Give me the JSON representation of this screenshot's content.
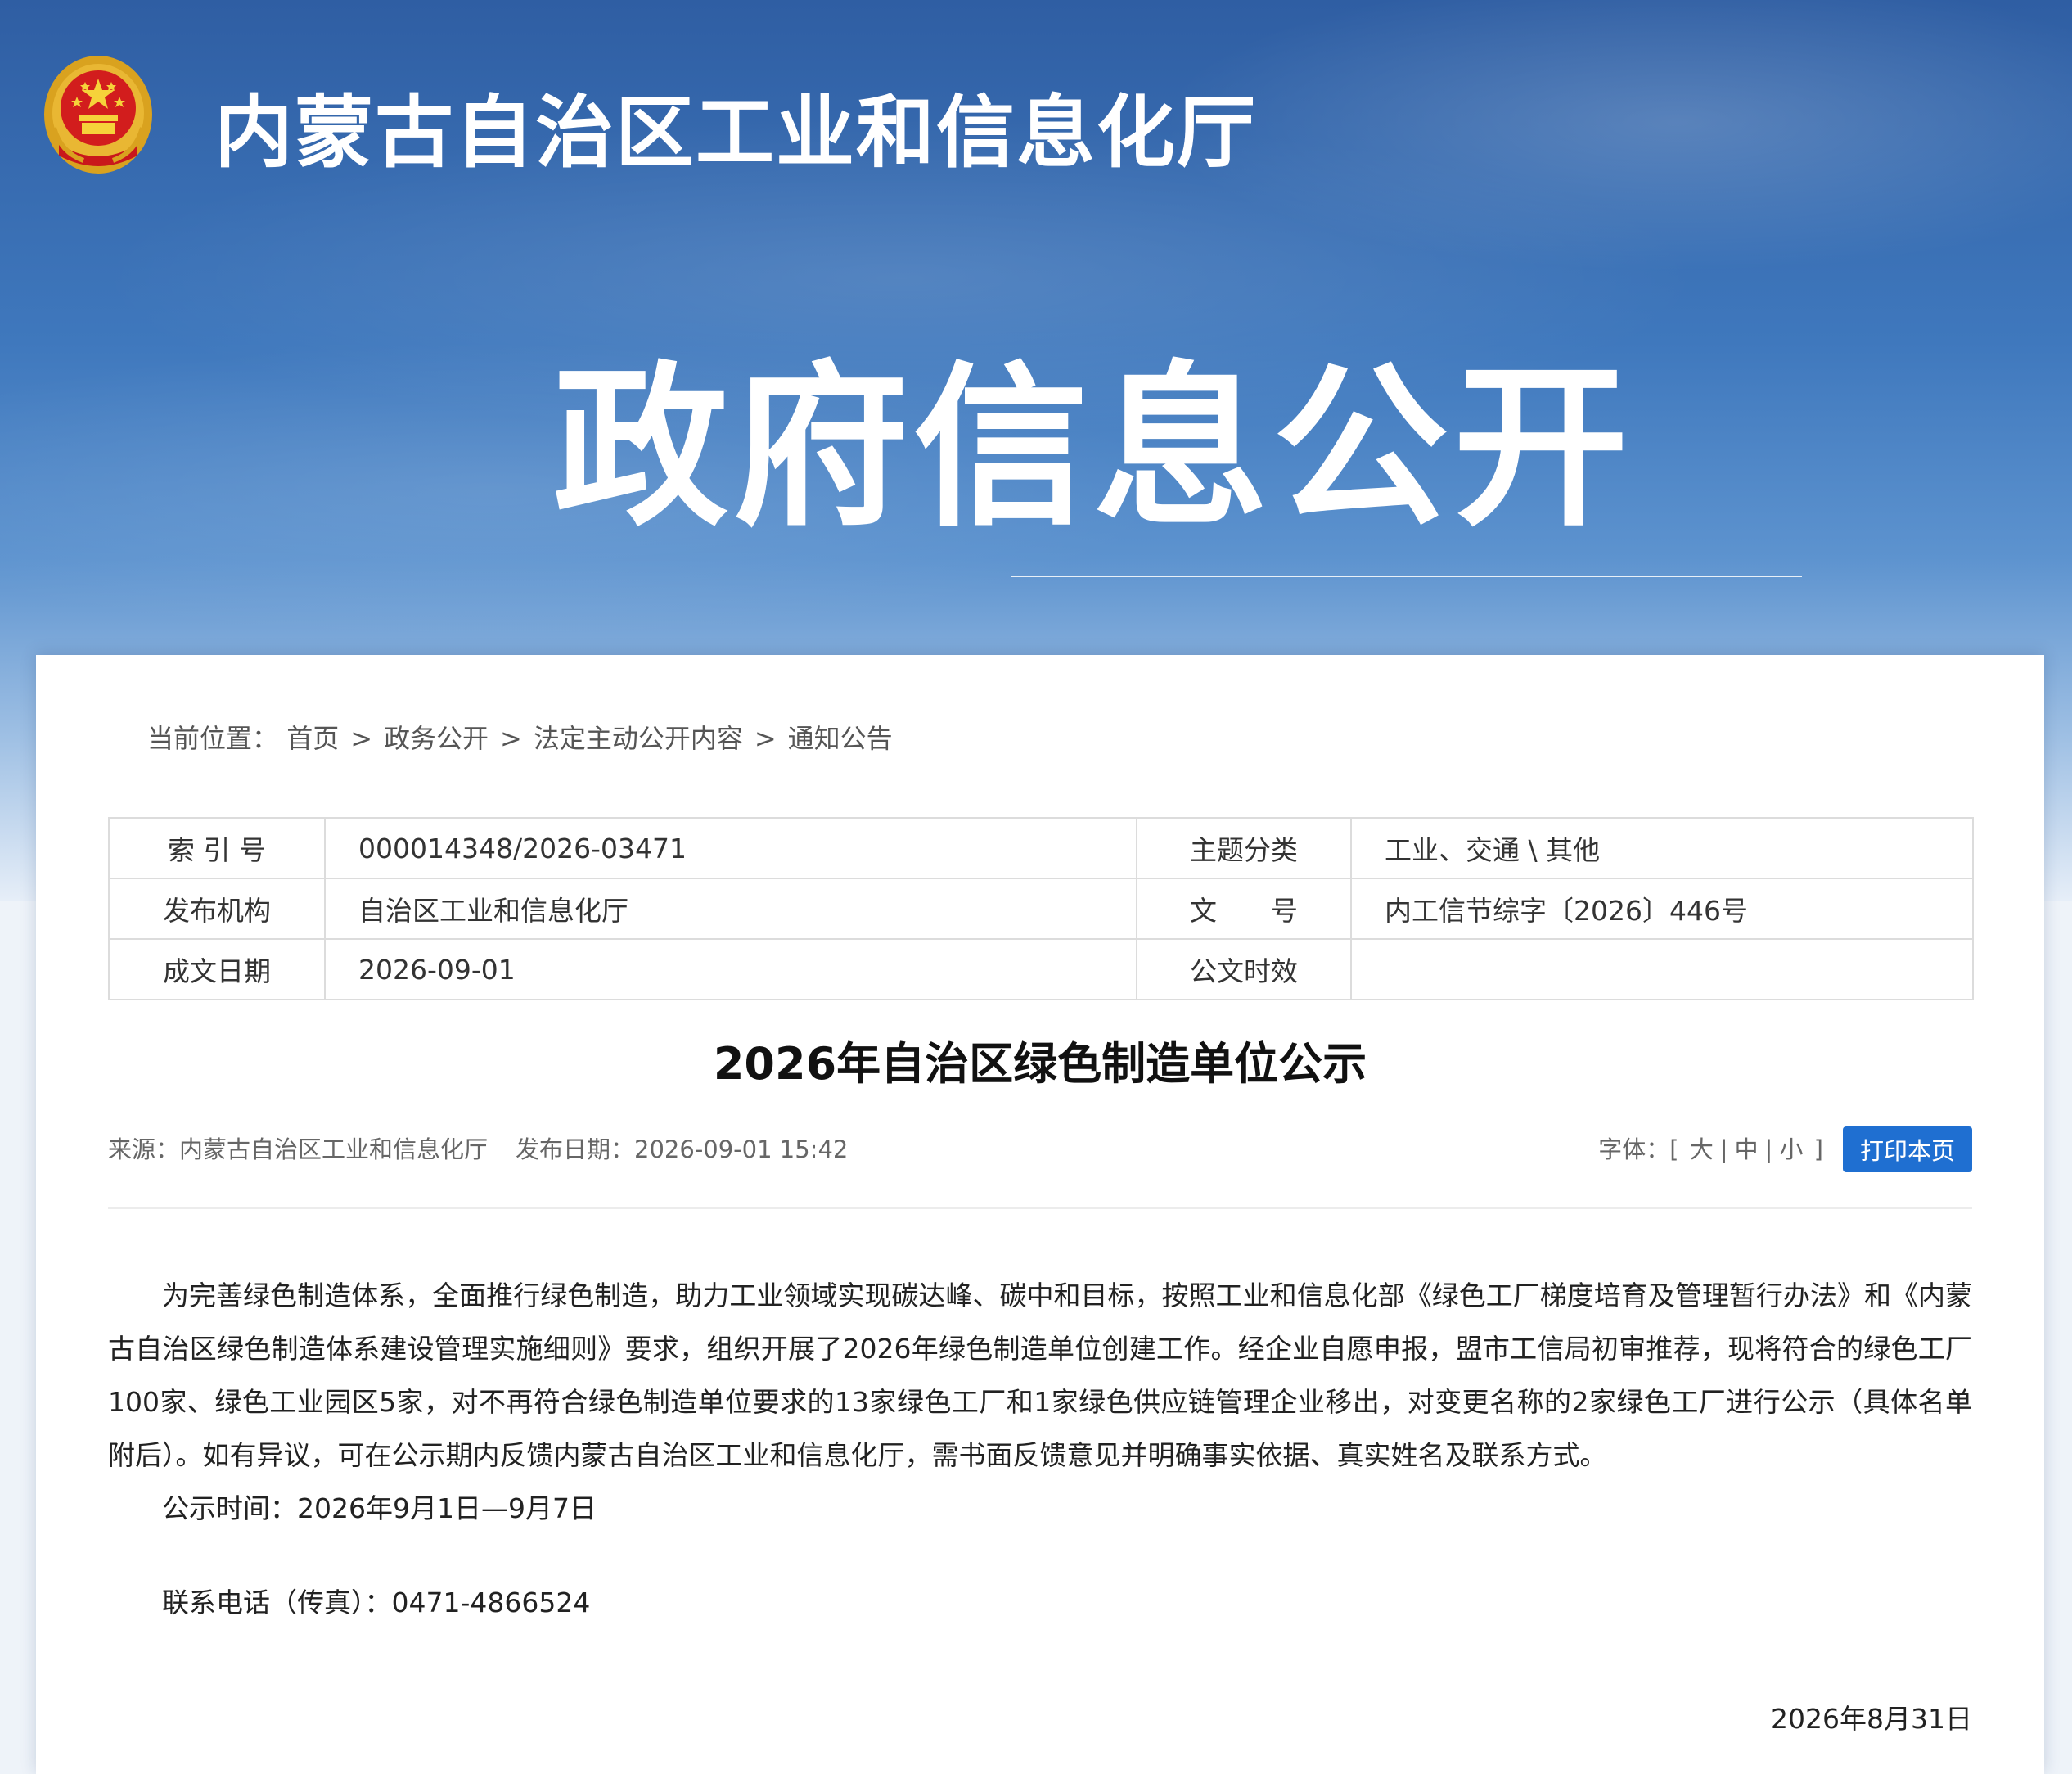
{
  "header": {
    "site_title": "内蒙古自治区工业和信息化厅",
    "hero_heading": "政府信息公开",
    "emblem_icon": "national-emblem-icon"
  },
  "breadcrumb": {
    "prefix": "当前位置：",
    "items": [
      "首页",
      "政务公开",
      "法定主动公开内容",
      "通知公告"
    ],
    "separator": ">"
  },
  "meta": {
    "rows": [
      {
        "label1": "索 引 号",
        "value1": "000014348/2026-03471",
        "label2": "主题分类",
        "value2": "工业、交通 \\ 其他"
      },
      {
        "label1": "发布机构",
        "value1": "自治区工业和信息化厅",
        "label2": "文　　号",
        "value2": "内工信节综字〔2026〕446号"
      },
      {
        "label1": "成文日期",
        "value1": "2026-09-01",
        "label2": "公文时效",
        "value2": ""
      }
    ]
  },
  "article": {
    "title": "2026年自治区绿色制造单位公示",
    "source": "来源：内蒙古自治区工业和信息化厅",
    "publish_date": "发布日期：2026-09-01 15:42",
    "font_size_label": "字体：[",
    "font_sizes": [
      "大",
      "中",
      "小"
    ],
    "font_size_close": "]",
    "print_label": "打印本页",
    "paragraphs": [
      "为完善绿色制造体系，全面推行绿色制造，助力工业领域实现碳达峰、碳中和目标，按照工业和信息化部《绿色工厂梯度培育及管理暂行办法》和《内蒙古自治区绿色制造体系建设管理实施细则》要求，组织开展了2026年绿色制造单位创建工作。经企业自愿申报，盟市工信局初审推荐，现将符合的绿色工厂100家、绿色工业园区5家，对不再符合绿色制造单位要求的13家绿色工厂和1家绿色供应链管理企业移出，对变更名称的2家绿色工厂进行公示（具体名单附后）。如有异议，可在公示期内反馈内蒙古自治区工业和信息化厅，需书面反馈意见并明确事实依据、真实姓名及联系方式。",
      "公示时间：2026年9月1日—9月7日",
      "联系电话（传真）：0471-4866524"
    ],
    "sign_date": "2026年8月31日"
  },
  "colors": {
    "header_blue": "#3f78bd",
    "print_button": "#1f6fd1"
  }
}
